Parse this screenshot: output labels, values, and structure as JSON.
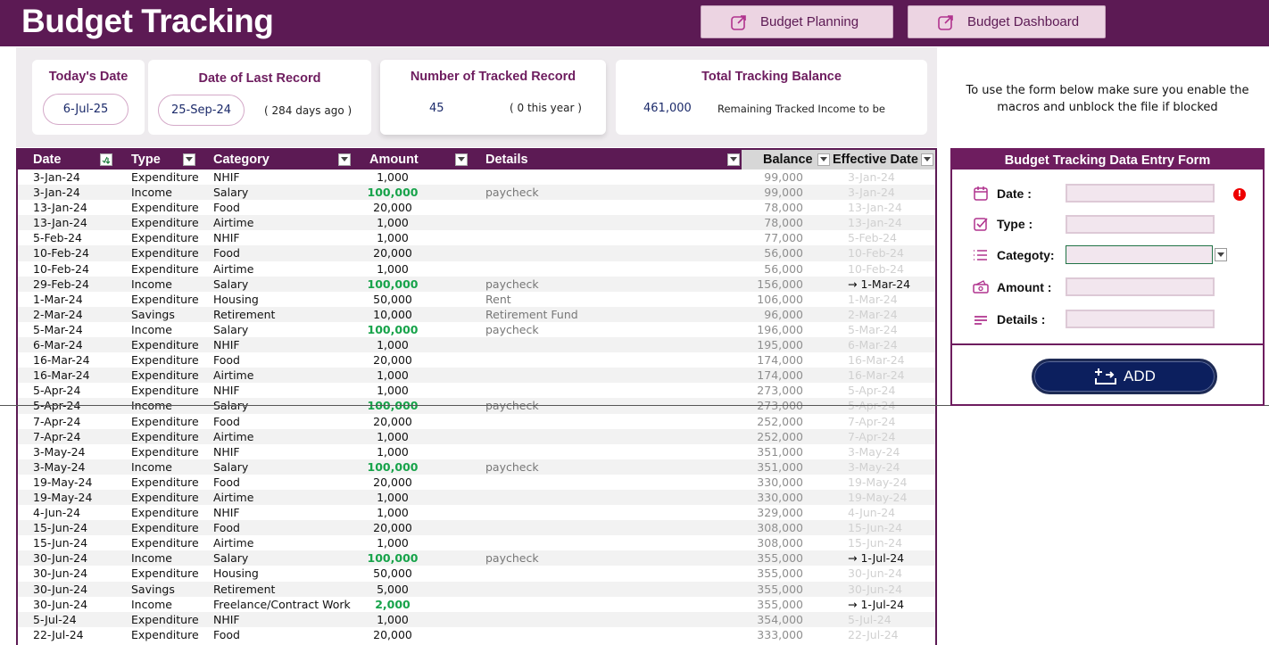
{
  "header": {
    "title": "Budget Tracking",
    "nav": {
      "planning": "Budget Planning",
      "dashboard": "Budget Dashboard"
    }
  },
  "kpis": {
    "today": {
      "title": "Today's Date",
      "value": "6-Jul-25"
    },
    "last_record": {
      "title": "Date of Last Record",
      "value": "25-Sep-24",
      "ago": "( 284 days ago )"
    },
    "tracked": {
      "title": "Number of Tracked Record",
      "value": "45",
      "this_year": "( 0 this year )"
    },
    "balance": {
      "title": "Total Tracking Balance",
      "value": "461,000",
      "note": "Remaining Tracked Income to be"
    }
  },
  "instructions": "To use the form below make sure you enable the macros and unblock the file if blocked",
  "table": {
    "columns": {
      "date": "Date",
      "type": "Type",
      "category": "Category",
      "amount": "Amount",
      "details": "Details",
      "balance": "Balance",
      "effective": "Effective Date"
    },
    "rows": [
      {
        "date": "3-Jan-24",
        "type": "Expenditure",
        "category": "NHIF",
        "amount": "1,000",
        "details": "",
        "balance": "99,000",
        "effective": "3-Jan-24",
        "income": false,
        "adj": false
      },
      {
        "date": "3-Jan-24",
        "type": "Income",
        "category": "Salary",
        "amount": "100,000",
        "details": "paycheck",
        "balance": "99,000",
        "effective": "3-Jan-24",
        "income": true,
        "adj": false
      },
      {
        "date": "13-Jan-24",
        "type": "Expenditure",
        "category": "Food",
        "amount": "20,000",
        "details": "",
        "balance": "78,000",
        "effective": "13-Jan-24",
        "income": false,
        "adj": false
      },
      {
        "date": "13-Jan-24",
        "type": "Expenditure",
        "category": "Airtime",
        "amount": "1,000",
        "details": "",
        "balance": "78,000",
        "effective": "13-Jan-24",
        "income": false,
        "adj": false
      },
      {
        "date": "5-Feb-24",
        "type": "Expenditure",
        "category": "NHIF",
        "amount": "1,000",
        "details": "",
        "balance": "77,000",
        "effective": "5-Feb-24",
        "income": false,
        "adj": false
      },
      {
        "date": "10-Feb-24",
        "type": "Expenditure",
        "category": "Food",
        "amount": "20,000",
        "details": "",
        "balance": "56,000",
        "effective": "10-Feb-24",
        "income": false,
        "adj": false
      },
      {
        "date": "10-Feb-24",
        "type": "Expenditure",
        "category": "Airtime",
        "amount": "1,000",
        "details": "",
        "balance": "56,000",
        "effective": "10-Feb-24",
        "income": false,
        "adj": false
      },
      {
        "date": "29-Feb-24",
        "type": "Income",
        "category": "Salary",
        "amount": "100,000",
        "details": "paycheck",
        "balance": "156,000",
        "effective": "→ 1-Mar-24",
        "income": true,
        "adj": true
      },
      {
        "date": "1-Mar-24",
        "type": "Expenditure",
        "category": "Housing",
        "amount": "50,000",
        "details": "Rent",
        "balance": "106,000",
        "effective": "1-Mar-24",
        "income": false,
        "adj": false
      },
      {
        "date": "2-Mar-24",
        "type": "Savings",
        "category": "Retirement",
        "amount": "10,000",
        "details": "Retirement Fund",
        "balance": "96,000",
        "effective": "2-Mar-24",
        "income": false,
        "adj": false
      },
      {
        "date": "5-Mar-24",
        "type": "Income",
        "category": "Salary",
        "amount": "100,000",
        "details": "paycheck",
        "balance": "196,000",
        "effective": "5-Mar-24",
        "income": true,
        "adj": false
      },
      {
        "date": "6-Mar-24",
        "type": "Expenditure",
        "category": "NHIF",
        "amount": "1,000",
        "details": "",
        "balance": "195,000",
        "effective": "6-Mar-24",
        "income": false,
        "adj": false
      },
      {
        "date": "16-Mar-24",
        "type": "Expenditure",
        "category": "Food",
        "amount": "20,000",
        "details": "",
        "balance": "174,000",
        "effective": "16-Mar-24",
        "income": false,
        "adj": false
      },
      {
        "date": "16-Mar-24",
        "type": "Expenditure",
        "category": "Airtime",
        "amount": "1,000",
        "details": "",
        "balance": "174,000",
        "effective": "16-Mar-24",
        "income": false,
        "adj": false
      },
      {
        "date": "5-Apr-24",
        "type": "Expenditure",
        "category": "NHIF",
        "amount": "1,000",
        "details": "",
        "balance": "273,000",
        "effective": "5-Apr-24",
        "income": false,
        "adj": false
      },
      {
        "date": "5-Apr-24",
        "type": "Income",
        "category": "Salary",
        "amount": "100,000",
        "details": "paycheck",
        "balance": "273,000",
        "effective": "5-Apr-24",
        "income": true,
        "adj": false
      },
      {
        "date": "7-Apr-24",
        "type": "Expenditure",
        "category": "Food",
        "amount": "20,000",
        "details": "",
        "balance": "252,000",
        "effective": "7-Apr-24",
        "income": false,
        "adj": false
      },
      {
        "date": "7-Apr-24",
        "type": "Expenditure",
        "category": "Airtime",
        "amount": "1,000",
        "details": "",
        "balance": "252,000",
        "effective": "7-Apr-24",
        "income": false,
        "adj": false
      },
      {
        "date": "3-May-24",
        "type": "Expenditure",
        "category": "NHIF",
        "amount": "1,000",
        "details": "",
        "balance": "351,000",
        "effective": "3-May-24",
        "income": false,
        "adj": false
      },
      {
        "date": "3-May-24",
        "type": "Income",
        "category": "Salary",
        "amount": "100,000",
        "details": "paycheck",
        "balance": "351,000",
        "effective": "3-May-24",
        "income": true,
        "adj": false
      },
      {
        "date": "19-May-24",
        "type": "Expenditure",
        "category": "Food",
        "amount": "20,000",
        "details": "",
        "balance": "330,000",
        "effective": "19-May-24",
        "income": false,
        "adj": false
      },
      {
        "date": "19-May-24",
        "type": "Expenditure",
        "category": "Airtime",
        "amount": "1,000",
        "details": "",
        "balance": "330,000",
        "effective": "19-May-24",
        "income": false,
        "adj": false
      },
      {
        "date": "4-Jun-24",
        "type": "Expenditure",
        "category": "NHIF",
        "amount": "1,000",
        "details": "",
        "balance": "329,000",
        "effective": "4-Jun-24",
        "income": false,
        "adj": false
      },
      {
        "date": "15-Jun-24",
        "type": "Expenditure",
        "category": "Food",
        "amount": "20,000",
        "details": "",
        "balance": "308,000",
        "effective": "15-Jun-24",
        "income": false,
        "adj": false
      },
      {
        "date": "15-Jun-24",
        "type": "Expenditure",
        "category": "Airtime",
        "amount": "1,000",
        "details": "",
        "balance": "308,000",
        "effective": "15-Jun-24",
        "income": false,
        "adj": false
      },
      {
        "date": "30-Jun-24",
        "type": "Income",
        "category": "Salary",
        "amount": "100,000",
        "details": "paycheck",
        "balance": "355,000",
        "effective": "→ 1-Jul-24",
        "income": true,
        "adj": true
      },
      {
        "date": "30-Jun-24",
        "type": "Expenditure",
        "category": "Housing",
        "amount": "50,000",
        "details": "",
        "balance": "355,000",
        "effective": "30-Jun-24",
        "income": false,
        "adj": false
      },
      {
        "date": "30-Jun-24",
        "type": "Savings",
        "category": "Retirement",
        "amount": "5,000",
        "details": "",
        "balance": "355,000",
        "effective": "30-Jun-24",
        "income": false,
        "adj": false
      },
      {
        "date": "30-Jun-24",
        "type": "Income",
        "category": "Freelance/Contract Work",
        "amount": "2,000",
        "details": "",
        "balance": "355,000",
        "effective": "→ 1-Jul-24",
        "income": true,
        "adj": true
      },
      {
        "date": "5-Jul-24",
        "type": "Expenditure",
        "category": "NHIF",
        "amount": "1,000",
        "details": "",
        "balance": "354,000",
        "effective": "5-Jul-24",
        "income": false,
        "adj": false
      },
      {
        "date": "22-Jul-24",
        "type": "Expenditure",
        "category": "Food",
        "amount": "20,000",
        "details": "",
        "balance": "333,000",
        "effective": "22-Jul-24",
        "income": false,
        "adj": false
      }
    ]
  },
  "form": {
    "title": "Budget Tracking Data Entry Form",
    "date_label": "Date :",
    "type_label": "Type :",
    "category_label": "Categoty:",
    "amount_label": "Amount :",
    "details_label": "Details :",
    "error_mark": "!",
    "add_label": "ADD"
  },
  "colors": {
    "brand": "#5c1a54",
    "income": "#17a34a",
    "button": "#0c1f5e"
  }
}
